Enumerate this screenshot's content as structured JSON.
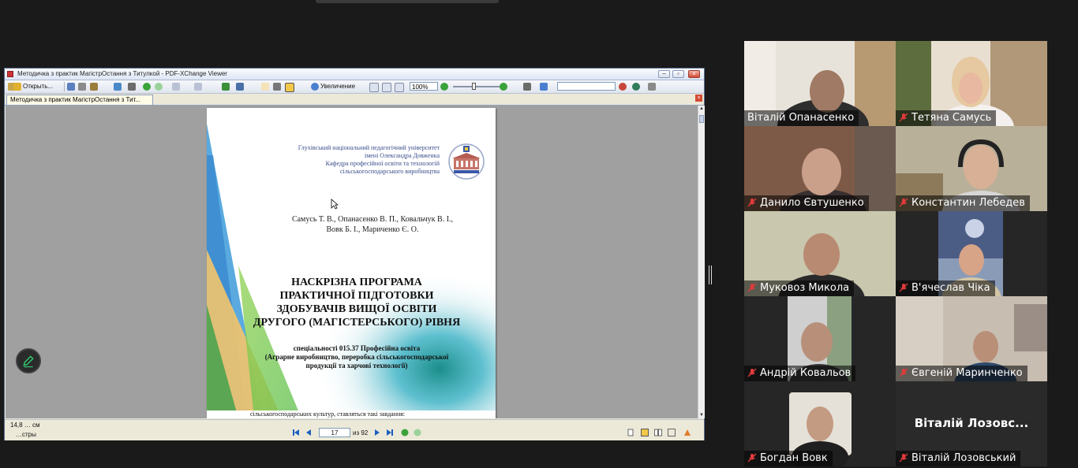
{
  "pdf_viewer": {
    "window_title": "Методичка з практик МагістрОстання з Титулкой - PDF-XChange Viewer",
    "toolbar": {
      "open_label": "Открыть...",
      "zoom_tool_label": "Увеличение",
      "zoom_value": "100%"
    },
    "tab_label": "Методичка з практик МагістрОстання з Тит...",
    "page": {
      "university_lines": [
        "Глухівський національний педагогічний університет",
        "імені Олександра Довженка",
        "Кафедра професійної освіти та технологій",
        "сільськогосподарського виробництва"
      ],
      "authors_lines": [
        "Самусь Т. В., Опанасенко В. П., Ковальчук В. І.,",
        "Вовк Б. І., Мариченко Є. О."
      ],
      "title_lines": [
        "НАСКРІЗНА ПРОГРАМА",
        "ПРАКТИЧНОЇ ПІДГОТОВКИ",
        "ЗДОБУВАЧІВ ВИЩОЇ ОСВІТИ",
        "ДРУГОГО (МАГІСТЕРСЬКОГО) РІВНЯ"
      ],
      "spec_lines": [
        "спеціальності 015.37 Професійна освіта",
        "(Аграрне виробництво, переробка сільськогосподарської",
        "продукції та харчові технології)"
      ],
      "next_page_text": "сільськогосподарських культур, ставляться такі завдання:"
    },
    "status": {
      "dimensions": "14,8 … см",
      "properties_label": "…стры",
      "current_page": "17",
      "of_pages": "из 92"
    },
    "colors": {
      "accent_green": "#3aa23a",
      "nav_blue": "#1c5fbf"
    }
  },
  "participants": [
    {
      "name": "Віталій Опанасенко",
      "muted": false,
      "active": true
    },
    {
      "name": "Тетяна Самусь",
      "muted": true,
      "active": false
    },
    {
      "name": "Данило Євтушенко",
      "muted": true,
      "active": false
    },
    {
      "name": "Константин Лебедев",
      "muted": true,
      "active": false
    },
    {
      "name": "Муковоз Микола",
      "muted": true,
      "active": false
    },
    {
      "name": "В'ячеслав Чіка",
      "muted": true,
      "active": false
    },
    {
      "name": "Андрій Ковальов",
      "muted": true,
      "active": false
    },
    {
      "name": "Євгеній Маринченко",
      "muted": true,
      "active": false
    },
    {
      "name": "Богдан Вовк",
      "muted": true,
      "active": false
    },
    {
      "name": "Віталій Лозовський",
      "muted": true,
      "active": false,
      "display_name": "Віталій  Лозовс..."
    }
  ]
}
